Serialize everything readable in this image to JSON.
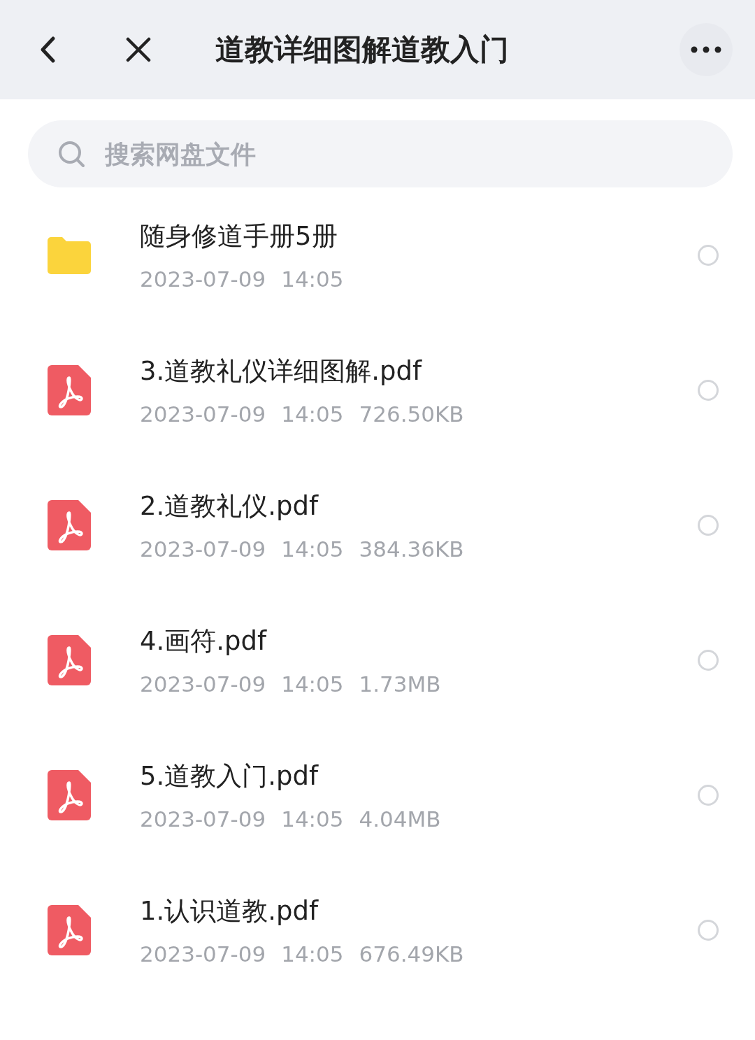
{
  "header": {
    "title": "道教详细图解道教入门"
  },
  "search": {
    "placeholder": "搜索网盘文件"
  },
  "files": [
    {
      "kind": "folder",
      "name": "随身修道手册5册",
      "date": "2023-07-09",
      "time": "14:05",
      "selected": false
    },
    {
      "kind": "pdf",
      "name": "3.道教礼仪详细图解.pdf",
      "date": "2023-07-09",
      "time": "14:05",
      "size": "726.50KB",
      "selected": false
    },
    {
      "kind": "pdf",
      "name": "2.道教礼仪.pdf",
      "date": "2023-07-09",
      "time": "14:05",
      "size": "384.36KB",
      "selected": false
    },
    {
      "kind": "pdf",
      "name": "4.画符.pdf",
      "date": "2023-07-09",
      "time": "14:05",
      "size": "1.73MB",
      "selected": false
    },
    {
      "kind": "pdf",
      "name": "5.道教入门.pdf",
      "date": "2023-07-09",
      "time": "14:05",
      "size": "4.04MB",
      "selected": false
    },
    {
      "kind": "pdf",
      "name": "1.认识道教.pdf",
      "date": "2023-07-09",
      "time": "14:05",
      "size": "676.49KB",
      "selected": false
    }
  ]
}
